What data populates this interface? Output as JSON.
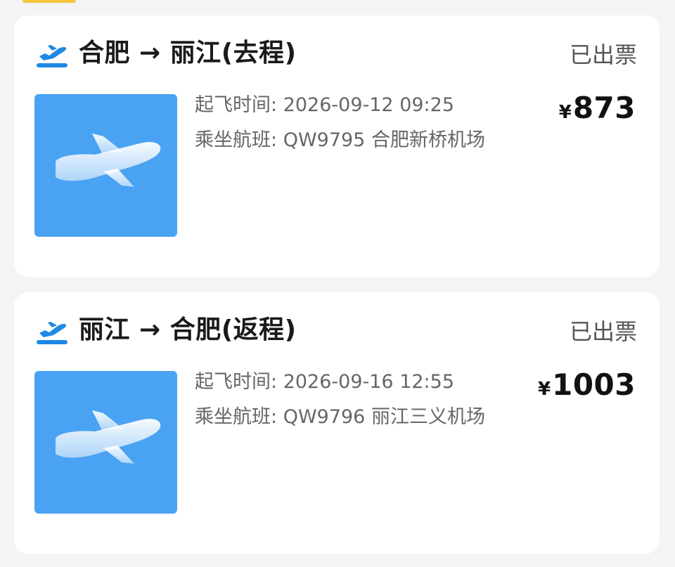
{
  "trips": [
    {
      "route_title": "合肥 → 丽江(去程)",
      "status": "已出票",
      "departure_label": "起飞时间:",
      "departure_value": "2026-09-12 09:25",
      "flight_label": "乘坐航班:",
      "flight_value": "QW9795 合肥新桥机场",
      "currency": "¥",
      "price": "873",
      "icon": "plane-takeoff-icon",
      "thumbnail_icon": "airplane-icon"
    },
    {
      "route_title": "丽江 → 合肥(返程)",
      "status": "已出票",
      "departure_label": "起飞时间:",
      "departure_value": "2026-09-16 12:55",
      "flight_label": "乘坐航班:",
      "flight_value": "QW9796 丽江三义机场",
      "currency": "¥",
      "price": "1003",
      "icon": "plane-takeoff-icon",
      "thumbnail_icon": "airplane-icon"
    }
  ],
  "colors": {
    "accent_blue": "#4aa2f2",
    "icon_blue": "#1e88e5",
    "top_tab_yellow": "#f7c63b",
    "card_bg": "#ffffff",
    "page_bg": "#f3f4f6"
  }
}
